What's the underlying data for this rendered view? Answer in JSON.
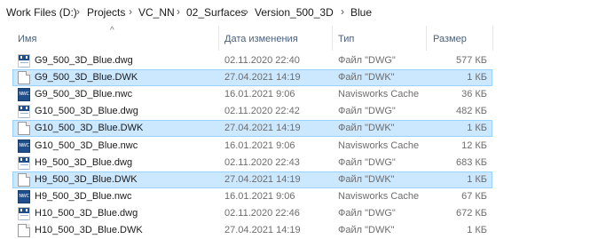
{
  "breadcrumb": {
    "items": [
      "Work Files (D:)",
      "Projects",
      "VC_NN",
      "02_Surfaces",
      "Version_500_3D",
      "Blue"
    ],
    "separator": "›"
  },
  "columns": {
    "name": "Имя",
    "date": "Дата изменения",
    "type": "Тип",
    "size": "Размер"
  },
  "sort_indicator": "^",
  "files": [
    {
      "name": "G9_500_3D_Blue.dwg",
      "date": "02.11.2020 22:40",
      "type": "Файл \"DWG\"",
      "size": "577 КБ",
      "icon": "dwg-file-icon",
      "selected": false
    },
    {
      "name": "G9_500_3D_Blue.DWK",
      "date": "27.04.2021 14:19",
      "type": "Файл \"DWK\"",
      "size": "1 КБ",
      "icon": "dwk-file-icon",
      "selected": true
    },
    {
      "name": "G9_500_3D_Blue.nwc",
      "date": "16.01.2021 9:06",
      "type": "Navisworks Cache",
      "size": "36 КБ",
      "icon": "nwc-file-icon",
      "selected": false
    },
    {
      "name": "G10_500_3D_Blue.dwg",
      "date": "02.11.2020 22:42",
      "type": "Файл \"DWG\"",
      "size": "482 КБ",
      "icon": "dwg-file-icon",
      "selected": false
    },
    {
      "name": "G10_500_3D_Blue.DWK",
      "date": "27.04.2021 14:19",
      "type": "Файл \"DWK\"",
      "size": "1 КБ",
      "icon": "dwk-file-icon",
      "selected": true
    },
    {
      "name": "G10_500_3D_Blue.nwc",
      "date": "16.01.2021 9:06",
      "type": "Navisworks Cache",
      "size": "12 КБ",
      "icon": "nwc-file-icon",
      "selected": false
    },
    {
      "name": "H9_500_3D_Blue.dwg",
      "date": "02.11.2020 22:43",
      "type": "Файл \"DWG\"",
      "size": "683 КБ",
      "icon": "dwg-file-icon",
      "selected": false
    },
    {
      "name": "H9_500_3D_Blue.DWK",
      "date": "27.04.2021 14:19",
      "type": "Файл \"DWK\"",
      "size": "1 КБ",
      "icon": "dwk-file-icon",
      "selected": true
    },
    {
      "name": "H9_500_3D_Blue.nwc",
      "date": "16.01.2021 9:06",
      "type": "Navisworks Cache",
      "size": "67 КБ",
      "icon": "nwc-file-icon",
      "selected": false
    },
    {
      "name": "H10_500_3D_Blue.dwg",
      "date": "02.11.2020 22:46",
      "type": "Файл \"DWG\"",
      "size": "672 КБ",
      "icon": "dwg-file-icon",
      "selected": false
    },
    {
      "name": "H10_500_3D_Blue.DWK",
      "date": "27.04.2021 14:19",
      "type": "Файл \"DWK\"",
      "size": "1 КБ",
      "icon": "dwk-file-icon",
      "selected": false
    }
  ],
  "colors": {
    "selection_bg": "#cce8ff",
    "selection_border": "#99d1ff",
    "header_text": "#4c607a",
    "muted_text": "#6d6d6d",
    "autocad_blue": "#1f4e8c"
  }
}
